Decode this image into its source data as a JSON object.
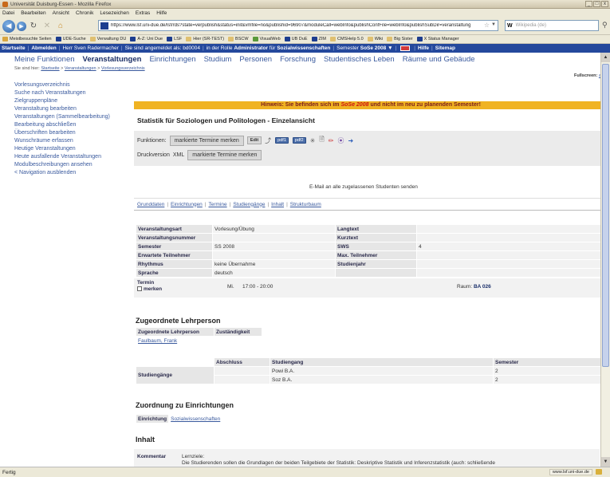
{
  "window": {
    "title": "Universität Duisburg-Essen - Mozilla Firefox",
    "buttons": [
      "_",
      "□",
      "x"
    ]
  },
  "menu": [
    "Datei",
    "Bearbeiten",
    "Ansicht",
    "Chronik",
    "Lesezeichen",
    "Extras",
    "Hilfe"
  ],
  "browser": {
    "url": "https://www.lsf.uni-due.de/lsf/rds?state=verpublish&status=init&vmfile=no&publishid=96907&moduleCall=webInfo&publishConfFile=webInfo&publishSubDir=veranstaltung",
    "search_engine": "W",
    "search_placeholder": "Wikipedia (de)"
  },
  "bookmarks": [
    {
      "label": "Meistbesuchte Seiten",
      "color": "#d9a640"
    },
    {
      "label": "UDE-Suche",
      "color": "#1d3d8f"
    },
    {
      "label": "Verwaltung DU",
      "color": "#e0c070"
    },
    {
      "label": "A-Z: Uni Due",
      "color": "#1d3d8f"
    },
    {
      "label": "LSF",
      "color": "#1d3d8f"
    },
    {
      "label": "Hier (SR-TEST)",
      "color": "#e0c070"
    },
    {
      "label": "BSCW",
      "color": "#e0c070"
    },
    {
      "label": "VisualWeb",
      "color": "#5a9a3a"
    },
    {
      "label": "UB DuE",
      "color": "#1d3d8f"
    },
    {
      "label": "ZIM",
      "color": "#1d3d8f"
    },
    {
      "label": "CMSHelp 5.0",
      "color": "#e0c070"
    },
    {
      "label": "Wiki",
      "color": "#e0c070"
    },
    {
      "label": "Big Sister",
      "color": "#e0c070"
    },
    {
      "label": "X Status Manager",
      "color": "#1d3d8f"
    }
  ],
  "topbar": {
    "startseite": "Startseite",
    "abmelden": "Abmelden",
    "user_text": "Herr Sven Radermacher",
    "login_text": "Sie sind angemeldet als:",
    "account": "bd0004",
    "role_text": "in der Rolle",
    "role": "Administrator",
    "for_text": "für",
    "area": "Sozialwissenschaften",
    "semester_label": "Semester",
    "semester": "SoSe 2008",
    "hilfe": "Hilfe",
    "sitemap": "Sitemap"
  },
  "mainnav": [
    "Meine Funktionen",
    "Veranstaltungen",
    "Einrichtungen",
    "Studium",
    "Personen",
    "Forschung",
    "Studentisches Leben",
    "Räume und Gebäude"
  ],
  "breadcrumb": {
    "prefix": "Sie sind hier:",
    "items": [
      "Startseite",
      "Veranstaltungen",
      "Vorlesungsverzeichnis"
    ]
  },
  "fullscreen": {
    "label": "Fullscreen:",
    "on": "an",
    "off": "aus"
  },
  "sidebar": [
    "Vorlesungsverzeichnis",
    "Suche nach Veranstaltungen",
    "Zielgruppenpläne",
    "Veranstaltung bearbeiten",
    "Veranstaltungen (Sammelbearbeitung)",
    "Bearbeitung abschließen",
    "Überschriften bearbeiten",
    "Wunschräume erfassen",
    "Heutige Veranstaltungen",
    "Heute ausfallende Veranstaltungen",
    "Modulbeschreibungen ansehen",
    "< Navigation ausblenden"
  ],
  "hinweis": {
    "prefix": "Hinweis: Sie befinden sich im",
    "semester": "SoSe 2008",
    "suffix": "und nicht im neu zu planenden Semester!"
  },
  "detail_title": "Statistik für Soziologen und Politologen - Einzelansicht",
  "functions": {
    "label": "Funktionen:",
    "mark_button": "markierte Termine merken",
    "edit_button": "Edit",
    "pdf1": "pdf1",
    "pdf2": "pdf2",
    "print_label": "Druckversion",
    "xml_label": "XML",
    "mark_button2": "markierte Termine merken",
    "email": "E-Mail an alle zugelassenen Studenten senden"
  },
  "tabs": [
    "Grunddaten",
    "Einrichtungen",
    "Termine",
    "Studiengänge",
    "Inhalt",
    "Strukturbaum"
  ],
  "grunddaten": [
    {
      "l1": "Veranstaltungsart",
      "v1": "Vorlesung/Übung",
      "l2": "Langtext",
      "v2": ""
    },
    {
      "l1": "Veranstaltungsnummer",
      "v1": "",
      "l2": "Kurztext",
      "v2": ""
    },
    {
      "l1": "Semester",
      "v1": "SS 2008",
      "l2": "SWS",
      "v2": "4"
    },
    {
      "l1": "Erwartete Teilnehmer",
      "v1": "",
      "l2": "Max. Teilnehmer",
      "v2": ""
    },
    {
      "l1": "Rhythmus",
      "v1": "keine Übernahme",
      "l2": "Studienjahr",
      "v2": ""
    },
    {
      "l1": "Sprache",
      "v1": "deutsch",
      "l2": "",
      "v2": ""
    }
  ],
  "termin": {
    "label": "Termin",
    "checkbox_label": "merken",
    "day": "Mi.",
    "time": "17:00 - 20:00",
    "room_label": "Raum:",
    "room": "BA 026"
  },
  "lehrperson": {
    "title": "Zugeordnete Lehrperson",
    "headers": [
      "Zugeordnete Lehrperson",
      "Zuständigkeit"
    ],
    "rows": [
      {
        "name": "Faulbaum, Frank",
        "role": ""
      }
    ]
  },
  "studiengaenge": {
    "label": "Studiengänge",
    "headers": [
      "Abschluss",
      "Studiengang",
      "Semester"
    ],
    "rows": [
      {
        "abschluss": "",
        "studiengang": "Powi B.A.",
        "semester": "2"
      },
      {
        "abschluss": "",
        "studiengang": "Soz B.A.",
        "semester": "2"
      }
    ]
  },
  "einrichtungen": {
    "title": "Zuordnung zu Einrichtungen",
    "label": "Einrichtung",
    "value": "Sozialwissenschaften"
  },
  "inhalt": {
    "title": "Inhalt",
    "kommentar_label": "Kommentar",
    "heading": "Lernziele:",
    "text": "Die Studierenden sollen die Grundlagen der beiden Teilgebiete der Statistik: Deskriptive Statistik und Inferenzstatistik (auch: schließende"
  },
  "statusbar": {
    "text": "Fertig",
    "host": "www.lsf.uni-due.de"
  }
}
